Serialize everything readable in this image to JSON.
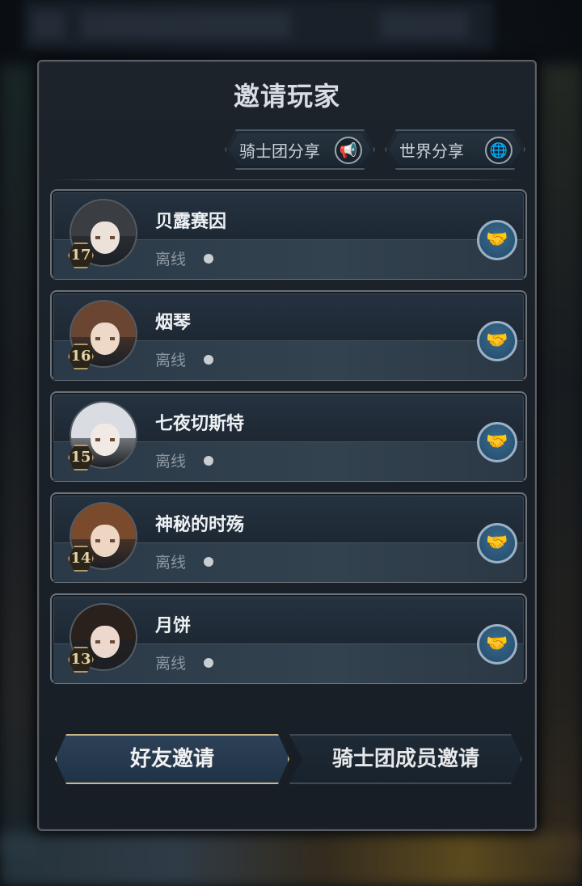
{
  "dialog": {
    "title": "邀请玩家"
  },
  "share_buttons": [
    {
      "label": "骑士团分享",
      "icon": "megaphone-icon"
    },
    {
      "label": "世界分享",
      "icon": "globe-megaphone-icon"
    }
  ],
  "players": [
    {
      "name": "贝露赛因",
      "level": "17",
      "status": "离线",
      "hair_color": "#3a3d42",
      "face_color": "#ece2da"
    },
    {
      "name": "烟琴",
      "level": "16",
      "status": "离线",
      "hair_color": "#6a4532",
      "face_color": "#eed8c8"
    },
    {
      "name": "七夜切斯特",
      "level": "15",
      "status": "离线",
      "hair_color": "#d9dde3",
      "face_color": "#f1e9e4"
    },
    {
      "name": "神秘的时殇",
      "level": "14",
      "status": "离线",
      "hair_color": "#7a4a2c",
      "face_color": "#edd6c2"
    },
    {
      "name": "月饼",
      "level": "13",
      "status": "离线",
      "hair_color": "#2a201c",
      "face_color": "#ecd8cc"
    }
  ],
  "tabs": {
    "friend_invite": "好友邀请",
    "guild_invite": "骑士团成员邀请",
    "active": "friend_invite"
  }
}
